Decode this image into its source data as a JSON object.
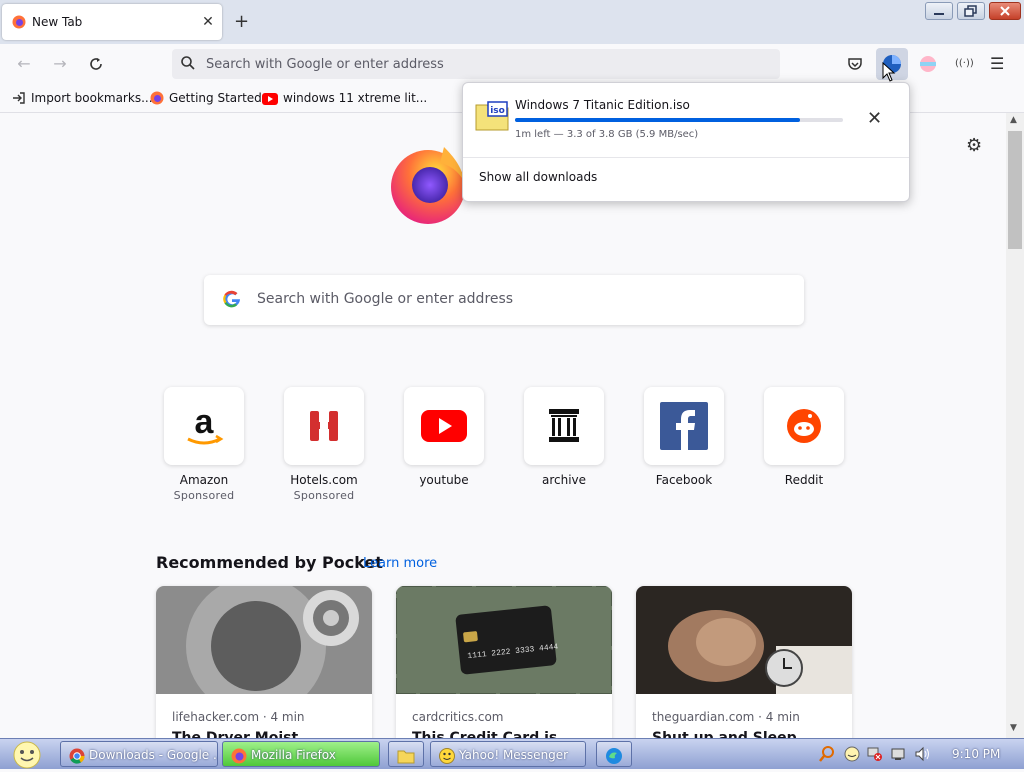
{
  "tab": {
    "title": "New Tab"
  },
  "toolbar": {
    "url_placeholder": "Search with Google or enter address"
  },
  "bookmarks": [
    {
      "label": "Import bookmarks..."
    },
    {
      "label": "Getting Started"
    },
    {
      "label": "windows 11 xtreme lit..."
    }
  ],
  "newtab": {
    "search_placeholder": "Search with Google or enter address",
    "tiles": [
      {
        "label": "Amazon",
        "sponsored": "Sponsored"
      },
      {
        "label": "Hotels.com",
        "sponsored": "Sponsored"
      },
      {
        "label": "youtube"
      },
      {
        "label": "archive"
      },
      {
        "label": "Facebook"
      },
      {
        "label": "Reddit"
      }
    ],
    "pocket": {
      "heading": "Recommended by Pocket",
      "learn_more": "Learn more",
      "cards": [
        {
          "source": "lifehacker.com · 4 min",
          "title": "The Dryer Moist..."
        },
        {
          "source": "cardcritics.com",
          "title": "This Credit Card is..."
        },
        {
          "source": "theguardian.com · 4 min",
          "title": "Shut up and Sleep..."
        }
      ]
    }
  },
  "downloads": {
    "filename": "Windows 7 Titanic Edition.iso",
    "file_badge": "iso",
    "progress": 0.87,
    "status": "1m left — 3.3 of 3.8 GB (5.9 MB/sec)",
    "show_all": "Show all downloads"
  },
  "taskbar": {
    "tasks": [
      {
        "label": "Downloads - Google ..."
      },
      {
        "label": "Mozilla Firefox"
      },
      {
        "label": "Yahoo! Messenger"
      }
    ],
    "clock": "9:10 PM"
  },
  "colors": {
    "accent": "#0060df",
    "taskbar": "#8ea0d2",
    "firefox_task": "#4fc83a"
  }
}
